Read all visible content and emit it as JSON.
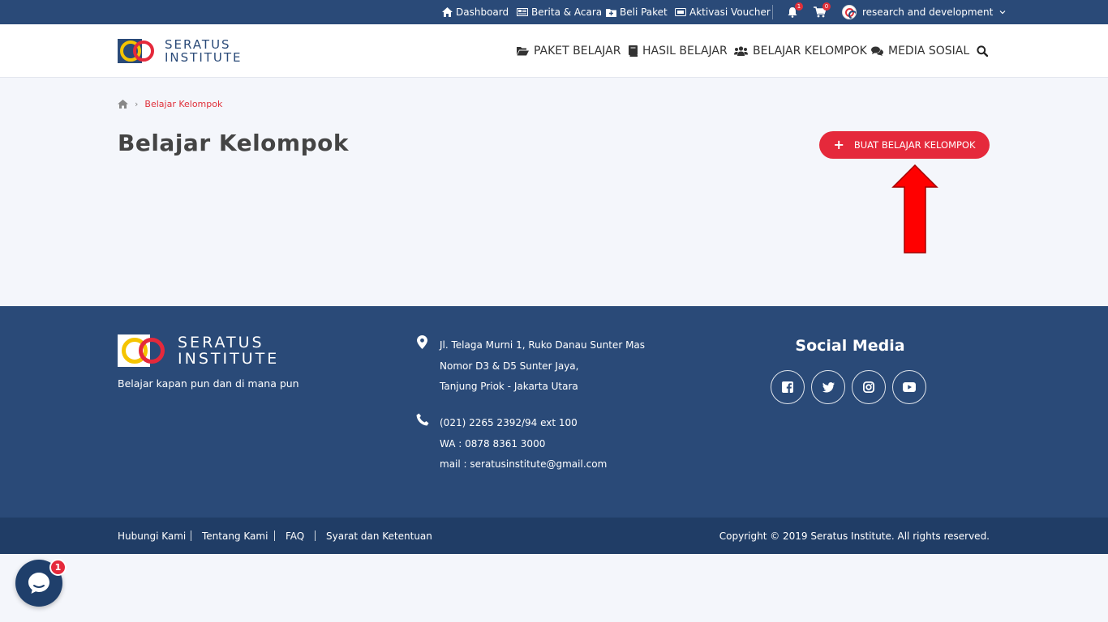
{
  "topbar": {
    "items": [
      {
        "label": "Dashboard",
        "icon": "home-icon"
      },
      {
        "label": "Berita & Acara",
        "icon": "newspaper-icon"
      },
      {
        "label": "Beli Paket",
        "icon": "folder-plus-icon"
      },
      {
        "label": "Aktivasi Voucher",
        "icon": "ticket-icon"
      }
    ],
    "notifications_count": "1",
    "cart_count": "0",
    "user_name": "research and development"
  },
  "header": {
    "logo_line1": "SERATUS",
    "logo_line2": "INSTITUTE",
    "nav": [
      {
        "label": "PAKET BELAJAR",
        "icon": "folder-open-icon"
      },
      {
        "label": "HASIL BELAJAR",
        "icon": "book-icon"
      },
      {
        "label": "BELAJAR KELOMPOK",
        "icon": "users-icon"
      },
      {
        "label": "MEDIA SOSIAL",
        "icon": "comments-icon"
      }
    ]
  },
  "breadcrumb": {
    "current": "Belajar Kelompok"
  },
  "page": {
    "title": "Belajar Kelompok",
    "create_button": "BUAT BELAJAR KELOMPOK"
  },
  "footer": {
    "logo_line1": "SERATUS",
    "logo_line2": "INSTITUTE",
    "tagline": "Belajar kapan pun dan di mana pun",
    "address": [
      "Jl. Telaga Murni 1, Ruko Danau Sunter Mas",
      "Nomor D3 & D5 Sunter Jaya,",
      "Tanjung Priok - Jakarta Utara"
    ],
    "contact": [
      "(021) 2265 2392/94 ext 100",
      "WA : 0878 8361 3000",
      "mail : seratusinstitute@gmail.com"
    ],
    "social_title": "Social Media",
    "social": [
      "facebook-icon",
      "twitter-icon",
      "instagram-icon",
      "youtube-icon"
    ],
    "links": [
      "Hubungi Kami",
      "Tentang Kami",
      "FAQ",
      "Syarat dan Ketentuan"
    ],
    "copyright": "Copyright © 2019 Seratus Institute. All rights reserved."
  },
  "chat": {
    "unread": "1"
  },
  "colors": {
    "primary_navy": "#2a4a78",
    "footer_bottom": "#203d66",
    "accent_red": "#e5293b",
    "page_bg": "#f4f6fb"
  }
}
